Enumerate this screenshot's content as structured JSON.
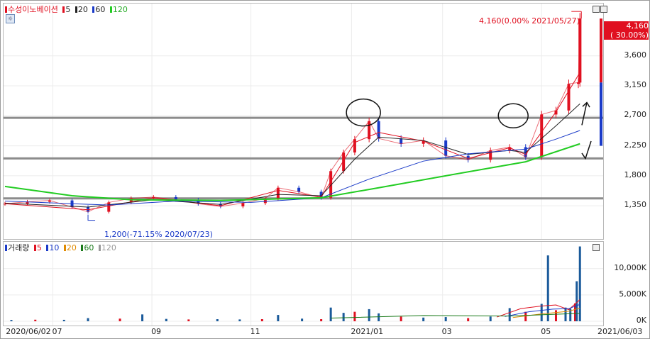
{
  "price_panel": {
    "stock_name": "수성이노베이션",
    "ma_labels": [
      "5",
      "20",
      "60",
      "120"
    ],
    "ma_colors": [
      "#e01020",
      "#222222",
      "#1a3ac8",
      "#22cc22"
    ],
    "current_price": "4,160",
    "current_change": "( 30.00%)",
    "high_annotation": "4,160(0.00% 2021/05/27)",
    "low_annotation": "1,200(-71.15% 2020/07/23)"
  },
  "volume_panel": {
    "title": "거래량",
    "ma_labels": [
      "5",
      "10",
      "20",
      "60",
      "120"
    ],
    "ma_colors": [
      "#e01020",
      "#1a3ac8",
      "#e08a00",
      "#1a7a1a",
      "#999999"
    ]
  },
  "chart_data": [
    {
      "type": "candlestick",
      "title": "수성이노베이션",
      "y_ticks": [
        "3,600",
        "3,150",
        "2,700",
        "2,250",
        "1,800",
        "1,350"
      ],
      "y_tick_values": [
        3600,
        3150,
        2700,
        2250,
        1800,
        1350
      ],
      "ylim": [
        1000,
        4300
      ],
      "x_tick_labels": [
        "2020/06/02",
        "07",
        "09",
        "11",
        "2021/01",
        "03",
        "05",
        "2021/06/03"
      ],
      "x_tick_dates": [
        "2020-06-02",
        "2020-07-01",
        "2020-09-01",
        "2020-11-02",
        "2021-01-04",
        "2021-03-02",
        "2021-05-03",
        "2021-06-03"
      ],
      "x_range": [
        "2020-06-01",
        "2021-06-03"
      ],
      "horizontal_lines": [
        2670,
        2060,
        1460
      ],
      "close_series": [
        [
          "2020-06-01",
          1380
        ],
        [
          "2020-06-15",
          1410
        ],
        [
          "2020-06-29",
          1430
        ],
        [
          "2020-07-13",
          1330
        ],
        [
          "2020-07-23",
          1260
        ],
        [
          "2020-08-05",
          1400
        ],
        [
          "2020-08-19",
          1460
        ],
        [
          "2020-09-02",
          1480
        ],
        [
          "2020-09-16",
          1440
        ],
        [
          "2020-09-30",
          1380
        ],
        [
          "2020-10-14",
          1340
        ],
        [
          "2020-10-28",
          1390
        ],
        [
          "2020-11-11",
          1460
        ],
        [
          "2020-11-19",
          1620
        ],
        [
          "2020-12-02",
          1560
        ],
        [
          "2020-12-16",
          1470
        ],
        [
          "2020-12-22",
          1870
        ],
        [
          "2020-12-30",
          2150
        ],
        [
          "2021-01-06",
          2350
        ],
        [
          "2021-01-15",
          2620
        ],
        [
          "2021-01-21",
          2360
        ],
        [
          "2021-02-04",
          2280
        ],
        [
          "2021-02-18",
          2330
        ],
        [
          "2021-03-04",
          2100
        ],
        [
          "2021-03-18",
          2040
        ],
        [
          "2021-04-01",
          2180
        ],
        [
          "2021-04-13",
          2230
        ],
        [
          "2021-04-23",
          2080
        ],
        [
          "2021-05-03",
          2720
        ],
        [
          "2021-05-12",
          2780
        ],
        [
          "2021-05-20",
          3180
        ],
        [
          "2021-05-26",
          3200
        ],
        [
          "2021-05-27",
          4160
        ]
      ],
      "ma_series": [
        {
          "name": "5",
          "values": [
            [
              "2020-06-01",
              1380
            ],
            [
              "2020-07-23",
              1290
            ],
            [
              "2020-09-02",
              1470
            ],
            [
              "2020-10-14",
              1350
            ],
            [
              "2020-11-19",
              1580
            ],
            [
              "2020-12-16",
              1480
            ],
            [
              "2021-01-06",
              2300
            ],
            [
              "2021-01-21",
              2450
            ],
            [
              "2021-02-18",
              2320
            ],
            [
              "2021-03-18",
              2060
            ],
            [
              "2021-04-13",
              2220
            ],
            [
              "2021-04-23",
              2120
            ],
            [
              "2021-05-12",
              2760
            ],
            [
              "2021-05-27",
              3350
            ]
          ]
        },
        {
          "name": "20",
          "values": [
            [
              "2020-06-01",
              1390
            ],
            [
              "2020-07-23",
              1330
            ],
            [
              "2020-09-02",
              1440
            ],
            [
              "2020-10-14",
              1370
            ],
            [
              "2020-11-19",
              1520
            ],
            [
              "2020-12-16",
              1500
            ],
            [
              "2021-01-06",
              2050
            ],
            [
              "2021-01-21",
              2380
            ],
            [
              "2021-02-18",
              2330
            ],
            [
              "2021-03-18",
              2120
            ],
            [
              "2021-04-13",
              2180
            ],
            [
              "2021-04-23",
              2150
            ],
            [
              "2021-05-12",
              2550
            ],
            [
              "2021-05-27",
              2880
            ]
          ]
        },
        {
          "name": "60",
          "values": [
            [
              "2020-06-01",
              1420
            ],
            [
              "2020-08-05",
              1360
            ],
            [
              "2020-09-16",
              1420
            ],
            [
              "2020-11-02",
              1400
            ],
            [
              "2020-12-16",
              1470
            ],
            [
              "2021-01-15",
              1750
            ],
            [
              "2021-02-18",
              2020
            ],
            [
              "2021-03-18",
              2130
            ],
            [
              "2021-04-23",
              2200
            ],
            [
              "2021-05-12",
              2350
            ],
            [
              "2021-05-27",
              2480
            ]
          ]
        },
        {
          "name": "120",
          "values": [
            [
              "2020-06-01",
              1640
            ],
            [
              "2020-07-13",
              1500
            ],
            [
              "2020-08-19",
              1440
            ],
            [
              "2020-10-14",
              1430
            ],
            [
              "2020-12-16",
              1470
            ],
            [
              "2021-01-21",
              1620
            ],
            [
              "2021-03-04",
              1800
            ],
            [
              "2021-04-23",
              2010
            ],
            [
              "2021-05-27",
              2280
            ]
          ]
        }
      ]
    },
    {
      "type": "bar",
      "title": "거래량",
      "y_ticks": [
        "10,000K",
        "5,000K",
        "0K"
      ],
      "y_tick_values": [
        10000,
        5000,
        0
      ],
      "ylim": [
        0,
        14000
      ],
      "x_range": [
        "2020-06-01",
        "2021-06-03"
      ],
      "values": [
        [
          "2020-06-05",
          250
        ],
        [
          "2020-06-20",
          300
        ],
        [
          "2020-07-08",
          280
        ],
        [
          "2020-07-23",
          600
        ],
        [
          "2020-08-12",
          500
        ],
        [
          "2020-08-26",
          1300
        ],
        [
          "2020-09-10",
          450
        ],
        [
          "2020-09-24",
          350
        ],
        [
          "2020-10-12",
          400
        ],
        [
          "2020-10-26",
          350
        ],
        [
          "2020-11-09",
          400
        ],
        [
          "2020-11-19",
          1200
        ],
        [
          "2020-12-04",
          500
        ],
        [
          "2020-12-16",
          400
        ],
        [
          "2020-12-22",
          2600
        ],
        [
          "2020-12-30",
          1600
        ],
        [
          "2021-01-06",
          1800
        ],
        [
          "2021-01-15",
          2300
        ],
        [
          "2021-01-21",
          1500
        ],
        [
          "2021-02-04",
          900
        ],
        [
          "2021-02-18",
          700
        ],
        [
          "2021-03-04",
          800
        ],
        [
          "2021-03-18",
          600
        ],
        [
          "2021-04-01",
          900
        ],
        [
          "2021-04-13",
          2500
        ],
        [
          "2021-04-23",
          1800
        ],
        [
          "2021-05-03",
          3300
        ],
        [
          "2021-05-07",
          12500
        ],
        [
          "2021-05-12",
          2100
        ],
        [
          "2021-05-18",
          2600
        ],
        [
          "2021-05-21",
          2400
        ],
        [
          "2021-05-24",
          3400
        ],
        [
          "2021-05-25",
          7600
        ],
        [
          "2021-05-27",
          14200
        ]
      ],
      "ma_series": [
        {
          "name": "5",
          "values": [
            [
              "2021-04-05",
              800
            ],
            [
              "2021-04-20",
              2400
            ],
            [
              "2021-05-03",
              2900
            ],
            [
              "2021-05-12",
              3100
            ],
            [
              "2021-05-20",
              2200
            ],
            [
              "2021-05-27",
              4100
            ]
          ]
        },
        {
          "name": "10",
          "values": [
            [
              "2021-04-10",
              900
            ],
            [
              "2021-04-25",
              1800
            ],
            [
              "2021-05-10",
              2300
            ],
            [
              "2021-05-20",
              2400
            ],
            [
              "2021-05-27",
              3200
            ]
          ]
        },
        {
          "name": "20",
          "values": [
            [
              "2021-04-15",
              700
            ],
            [
              "2021-05-03",
              1400
            ],
            [
              "2021-05-20",
              1900
            ],
            [
              "2021-05-27",
              2500
            ]
          ]
        },
        {
          "name": "60",
          "values": [
            [
              "2020-12-22",
              600
            ],
            [
              "2021-02-18",
              1100
            ],
            [
              "2021-04-13",
              1000
            ],
            [
              "2021-05-27",
              1500
            ]
          ]
        }
      ]
    }
  ]
}
